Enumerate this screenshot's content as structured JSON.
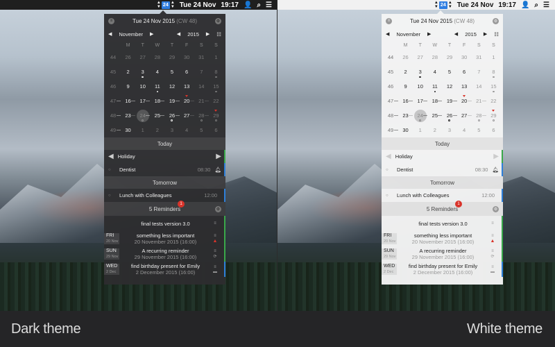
{
  "menubar": {
    "date_box": "24",
    "date_text": "Tue 24 Nov",
    "time": "19:17"
  },
  "panel": {
    "header_date": "Tue 24 Nov 2015",
    "header_cw": "(CW 48)",
    "month": "November",
    "year": "2015",
    "weekdays": [
      "M",
      "T",
      "W",
      "T",
      "F",
      "S",
      "S"
    ],
    "weeks": [
      {
        "wk": "44",
        "days": [
          "26",
          "27",
          "28",
          "29",
          "30",
          "31",
          "1"
        ]
      },
      {
        "wk": "45",
        "days": [
          "2",
          "3",
          "4",
          "5",
          "6",
          "7",
          "8"
        ]
      },
      {
        "wk": "46",
        "days": [
          "9",
          "10",
          "11",
          "12",
          "13",
          "14",
          "15"
        ]
      },
      {
        "wk": "47",
        "days": [
          "16",
          "17",
          "18",
          "19",
          "20",
          "21",
          "22"
        ]
      },
      {
        "wk": "48",
        "days": [
          "23",
          "24",
          "25",
          "26",
          "27",
          "28",
          "29"
        ]
      },
      {
        "wk": "49",
        "days": [
          "30",
          "1",
          "2",
          "3",
          "4",
          "5",
          "6"
        ]
      }
    ],
    "today_label": "Today",
    "today_events": [
      {
        "name": "Holiday",
        "time": "",
        "bar": "#3aa84a"
      },
      {
        "name": "Dentist",
        "time": "08:30",
        "bar": "#2e7fd9"
      }
    ],
    "tomorrow_label": "Tomorrow",
    "tomorrow_events": [
      {
        "name": "Lunch with Colleagues",
        "time": "12:00",
        "bar": "#2e7fd9"
      }
    ],
    "reminders_label": "5 Reminders",
    "reminders_badge": "1",
    "reminders": [
      {
        "dow": "",
        "date": "",
        "title": "final tests version 3.0",
        "sub": "",
        "bar": "#3aa84a"
      },
      {
        "dow": "FRI",
        "date": "20 Nov",
        "title": "something less important",
        "sub": "20 November 2015 (16:00)",
        "bar": "#3aa84a"
      },
      {
        "dow": "SUN",
        "date": "29 Nov",
        "title": "A recurring reminder",
        "sub": "29 November 2015 (16:00)",
        "bar": "#3aa84a"
      },
      {
        "dow": "WED",
        "date": "2 Dec",
        "title": "find birthday present for Emily",
        "sub": "2 December 2015 (16:00)",
        "bar": "#2e7fd9"
      }
    ]
  },
  "captions": {
    "left": "Dark theme",
    "right": "White theme"
  },
  "colors": {
    "accent_blue": "#2e7fd9",
    "warning_red": "#d9342b",
    "holiday_green": "#3aa84a"
  }
}
